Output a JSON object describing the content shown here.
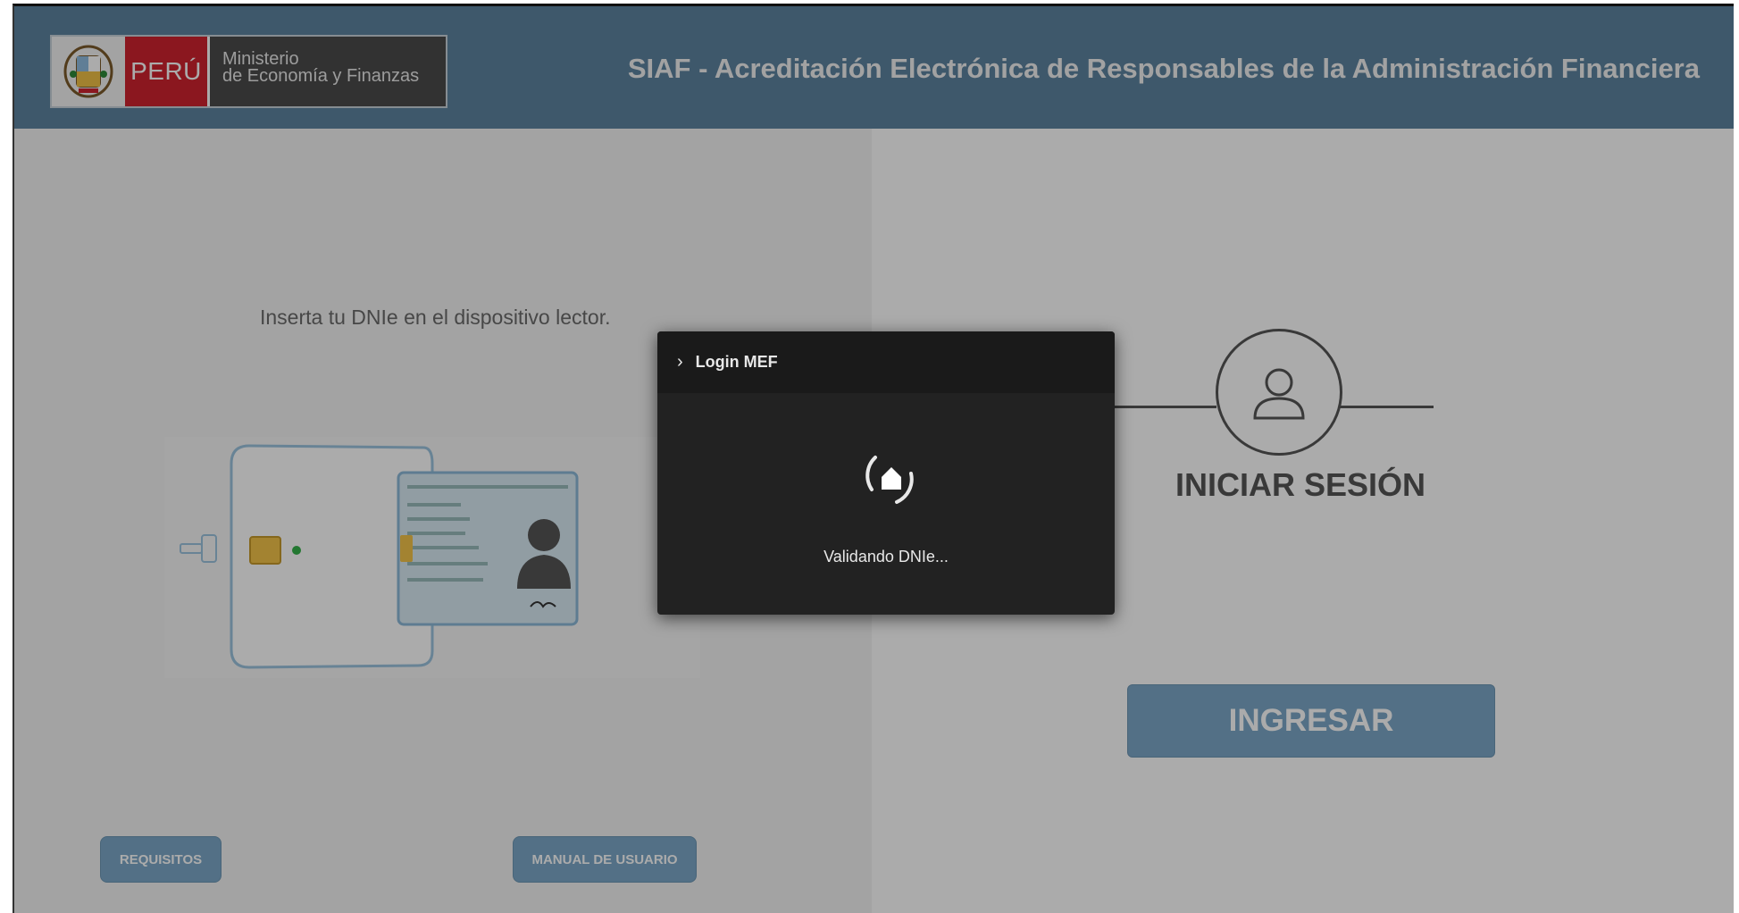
{
  "header": {
    "logo": {
      "country": "PERÚ",
      "ministry_line1": "Ministerio",
      "ministry_line2": "de Economía y Finanzas"
    },
    "title": "SIAF - Acreditación Electrónica de Responsables de la Administración Financiera"
  },
  "left": {
    "instruction": "Inserta tu DNIe en el dispositivo lector.",
    "buttons": {
      "requirements": "REQUISITOS",
      "manual": "MANUAL DE USUARIO"
    }
  },
  "right": {
    "login_title": "INICIAR SESIÓN",
    "enter_button": "INGRESAR"
  },
  "modal": {
    "title": "Login MEF",
    "status": "Validando DNIe..."
  },
  "colors": {
    "header": "#5d84a0",
    "button": "#7ca8c8",
    "modal": "#222222"
  },
  "icons": [
    "peru-shield-icon",
    "card-reader-icon",
    "user-icon",
    "chevron-right-icon",
    "home-spinner-icon"
  ]
}
